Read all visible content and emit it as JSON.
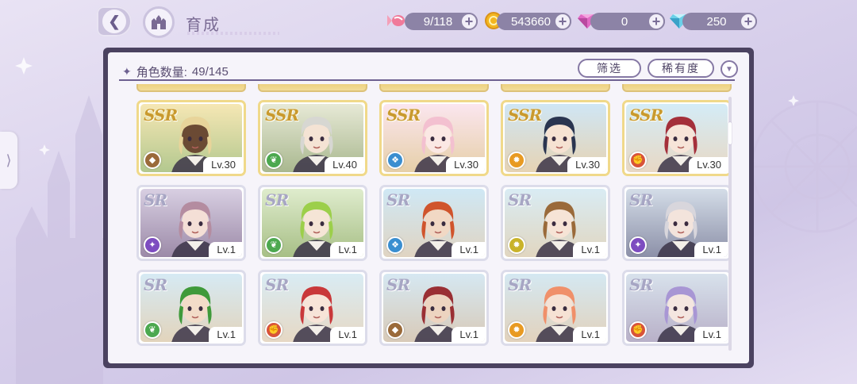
{
  "header": {
    "title": "育成",
    "back_icon": "back-arrow-icon",
    "home_icon": "castle-home-icon"
  },
  "resources": [
    {
      "name": "candy",
      "icon": "candy-icon",
      "value": "9/118"
    },
    {
      "name": "gold",
      "icon": "gold-coin-icon",
      "value": "543660"
    },
    {
      "name": "pink-gem",
      "icon": "pink-diamond-icon",
      "value": "0"
    },
    {
      "name": "blue-gem",
      "icon": "blue-diamond-icon",
      "value": "250"
    }
  ],
  "panel": {
    "count_label": "角色数量:",
    "count_value": "49/145",
    "filter_button": "筛选",
    "rarity_button": "稀有度",
    "sort_icon": "chevron-down-icon"
  },
  "characters": [
    {
      "rarity": "SSR",
      "level": "Lv.30",
      "element": "earth",
      "elementColor": "#9a6a3a",
      "hair": "#e8d49a",
      "skin": "#6b4a34",
      "bg": [
        "#f6e7b4",
        "#b3c88f"
      ]
    },
    {
      "rarity": "SSR",
      "level": "Lv.40",
      "element": "wind",
      "elementColor": "#4ca84f",
      "hair": "#d7d7d2",
      "skin": "#f4e3d4",
      "bg": [
        "#e7e9d6",
        "#a9b88f"
      ]
    },
    {
      "rarity": "SSR",
      "level": "Lv.30",
      "element": "water",
      "elementColor": "#3a8ed0",
      "hair": "#f3c0d0",
      "skin": "#fbe8e4",
      "bg": [
        "#fbe6ef",
        "#e6cfa8"
      ]
    },
    {
      "rarity": "SSR",
      "level": "Lv.30",
      "element": "light",
      "elementColor": "#e89a22",
      "hair": "#2a3550",
      "skin": "#f6e2d2",
      "bg": [
        "#cfe6f5",
        "#e6d3b3"
      ]
    },
    {
      "rarity": "SSR",
      "level": "Lv.30",
      "element": "fire",
      "elementColor": "#d8533a",
      "hair": "#a42f3a",
      "skin": "#f7e4d8",
      "bg": [
        "#d4ecf7",
        "#e8d8c4"
      ]
    },
    {
      "rarity": "SR",
      "level": "Lv.1",
      "element": "dark",
      "elementColor": "#7d4cc0",
      "hair": "#b48ca0",
      "skin": "#f4dfd6",
      "bg": [
        "#d8cfe2",
        "#9c8aa8"
      ]
    },
    {
      "rarity": "SR",
      "level": "Lv.1",
      "element": "wind",
      "elementColor": "#4ca84f",
      "hair": "#9ccf4a",
      "skin": "#f5e5d6",
      "bg": [
        "#dfeccd",
        "#a7bf86"
      ]
    },
    {
      "rarity": "SR",
      "level": "Lv.1",
      "element": "water",
      "elementColor": "#3a8ed0",
      "hair": "#d0542c",
      "skin": "#f1d8c4",
      "bg": [
        "#cfe8f5",
        "#e0d4c2"
      ]
    },
    {
      "rarity": "SR",
      "level": "Lv.1",
      "element": "light",
      "elementColor": "#c9b32a",
      "hair": "#9a6a3a",
      "skin": "#f6e4d6",
      "bg": [
        "#d9ecf4",
        "#e1d6c0"
      ]
    },
    {
      "rarity": "SR",
      "level": "Lv.1",
      "element": "dark",
      "elementColor": "#7d4cc0",
      "hair": "#d8d6dc",
      "skin": "#f3e4dc",
      "bg": [
        "#d4dde8",
        "#8c90a8"
      ]
    },
    {
      "rarity": "SR",
      "level": "Lv.1",
      "element": "wind",
      "elementColor": "#4ca84f",
      "hair": "#3f9a3a",
      "skin": "#f2dcc8",
      "bg": [
        "#d6eaf4",
        "#e2d4bc"
      ]
    },
    {
      "rarity": "SR",
      "level": "Lv.1",
      "element": "fire",
      "elementColor": "#d8533a",
      "hair": "#c9383a",
      "skin": "#f7e4d8",
      "bg": [
        "#d9ecf4",
        "#e6d8c4"
      ]
    },
    {
      "rarity": "SR",
      "level": "Lv.1",
      "element": "earth",
      "elementColor": "#9a6a3a",
      "hair": "#9a2f34",
      "skin": "#edd4c0",
      "bg": [
        "#d6e8f2",
        "#d8cab8"
      ]
    },
    {
      "rarity": "SR",
      "level": "Lv.1",
      "element": "light",
      "elementColor": "#e89a22",
      "hair": "#f0906a",
      "skin": "#f6e2d4",
      "bg": [
        "#d4e8f2",
        "#e2d2bc"
      ]
    },
    {
      "rarity": "SR",
      "level": "Lv.1",
      "element": "fire",
      "elementColor": "#d8533a",
      "hair": "#a896d4",
      "skin": "#f4e6e0",
      "bg": [
        "#d8e2ec",
        "#b8b0c8"
      ]
    }
  ],
  "side_handle_icon": "chevron-right-icon"
}
